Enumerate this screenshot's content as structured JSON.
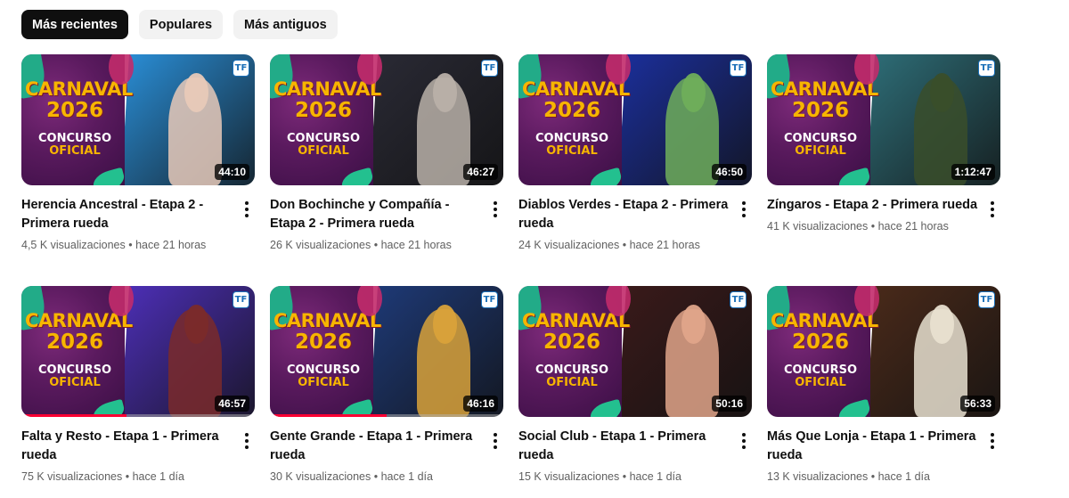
{
  "filters": [
    {
      "label": "Más recientes",
      "active": true
    },
    {
      "label": "Populares",
      "active": false
    },
    {
      "label": "Más antiguos",
      "active": false
    }
  ],
  "thumbnail_branding": {
    "title_line1": "CARNAVAL",
    "title_line2": "2026",
    "subtitle_line1": "CONCURSO",
    "subtitle_line2": "OFICIAL",
    "channel_badge": "TF"
  },
  "videos": [
    {
      "title": "Herencia Ancestral - Etapa 2 - Primera rueda",
      "views": "4,5 K visualizaciones",
      "age": "hace 21 horas",
      "duration": "44:10",
      "bg": "#2a8fd8",
      "accent": "#e8c9b8",
      "watched": 0
    },
    {
      "title": "Don Bochinche y Compañía - Etapa 2 - Primera rueda",
      "views": "26 K visualizaciones",
      "age": "hace 21 horas",
      "duration": "46:27",
      "bg": "#2a2a35",
      "accent": "#b9b0a8",
      "watched": 0
    },
    {
      "title": "Diablos Verdes - Etapa 2 - Primera rueda",
      "views": "24 K visualizaciones",
      "age": "hace 21 horas",
      "duration": "46:50",
      "bg": "#1b2f9c",
      "accent": "#6fae5a",
      "watched": 0
    },
    {
      "title": "Zíngaros - Etapa 2 - Primera rueda",
      "views": "41 K visualizaciones",
      "age": "hace 21 horas",
      "duration": "1:12:47",
      "bg": "#2e6e78",
      "accent": "#3a4e2a",
      "watched": 0
    },
    {
      "title": "Falta y Resto - Etapa 1 - Primera rueda",
      "views": "75 K visualizaciones",
      "age": "hace 1 día",
      "duration": "46:57",
      "bg": "#4d2fb8",
      "accent": "#7a2a2a",
      "watched": 0.45
    },
    {
      "title": "Gente Grande - Etapa 1 - Primera rueda",
      "views": "30 K visualizaciones",
      "age": "hace 1 día",
      "duration": "46:16",
      "bg": "#1e3a78",
      "accent": "#d9a23a",
      "watched": 0.5
    },
    {
      "title": "Social Club - Etapa 1 - Primera rueda",
      "views": "15 K visualizaciones",
      "age": "hace 1 día",
      "duration": "50:16",
      "bg": "#3a1a1a",
      "accent": "#e0a58a",
      "watched": 0
    },
    {
      "title": "Más Que Lonja - Etapa 1 - Primera rueda",
      "views": "13 K visualizaciones",
      "age": "hace 1 día",
      "duration": "56:33",
      "bg": "#4a2a1a",
      "accent": "#e8e0d0",
      "watched": 0
    }
  ]
}
